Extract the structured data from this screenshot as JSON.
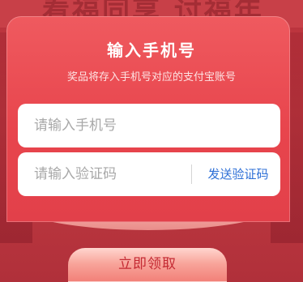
{
  "background": {
    "banner_text": "看福同享 讨福年"
  },
  "dialog": {
    "title": "输入手机号",
    "subtitle": "奖品将存入手机号对应的支付宝账号"
  },
  "phone_field": {
    "placeholder": "请输入手机号",
    "value": ""
  },
  "code_field": {
    "placeholder": "请输入验证码",
    "value": "",
    "send_code_label": "发送验证码"
  },
  "claim_button": {
    "label": "立即领取"
  },
  "colors": {
    "card": "#e8454d",
    "link": "#2d6fd6",
    "button_text": "#c42a33"
  }
}
